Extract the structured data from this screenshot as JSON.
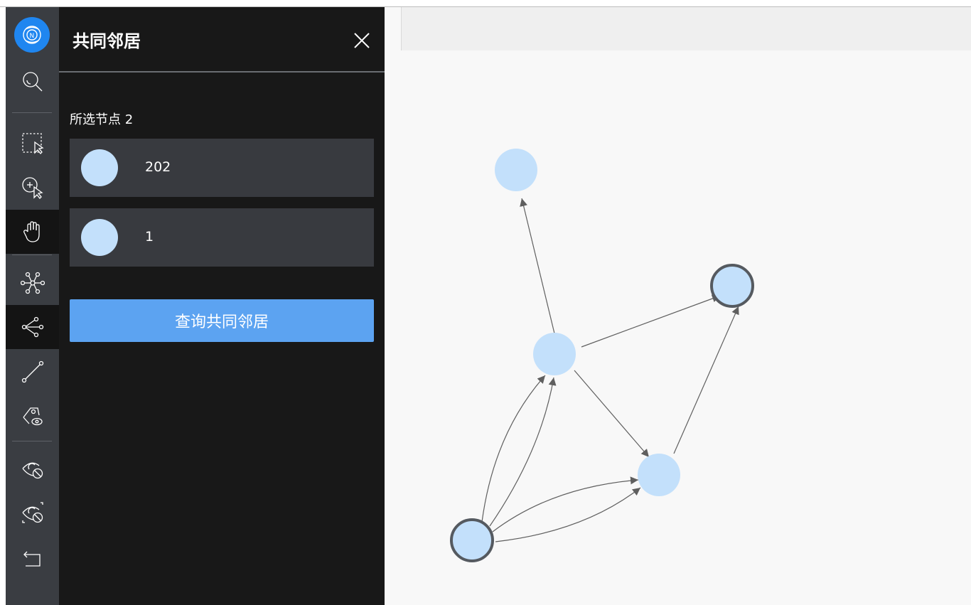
{
  "toolbar": {
    "tools": [
      {
        "name": "logo-icon",
        "active": false
      },
      {
        "name": "search-icon",
        "active": false
      },
      {
        "name": "box-select-icon",
        "active": false
      },
      {
        "name": "add-select-icon",
        "active": false
      },
      {
        "name": "hand-pan-icon",
        "active": true
      },
      {
        "name": "network-icon",
        "active": false
      },
      {
        "name": "common-neighbor-icon",
        "active": true
      },
      {
        "name": "path-icon",
        "active": false
      },
      {
        "name": "tag-eye-icon",
        "active": false
      },
      {
        "name": "hide-icon",
        "active": false
      },
      {
        "name": "hide-invert-icon",
        "active": false
      },
      {
        "name": "undo-icon",
        "active": false
      }
    ]
  },
  "panel": {
    "title": "共同邻居",
    "selected_label": "所选节点 2",
    "nodes": [
      {
        "label": "202"
      },
      {
        "label": "1"
      }
    ],
    "query_button": "查询共同邻居"
  },
  "graph": {
    "node_color": "#c3e0fb",
    "selected_stroke": "#555a60",
    "edge_color": "#5f5f5f"
  }
}
